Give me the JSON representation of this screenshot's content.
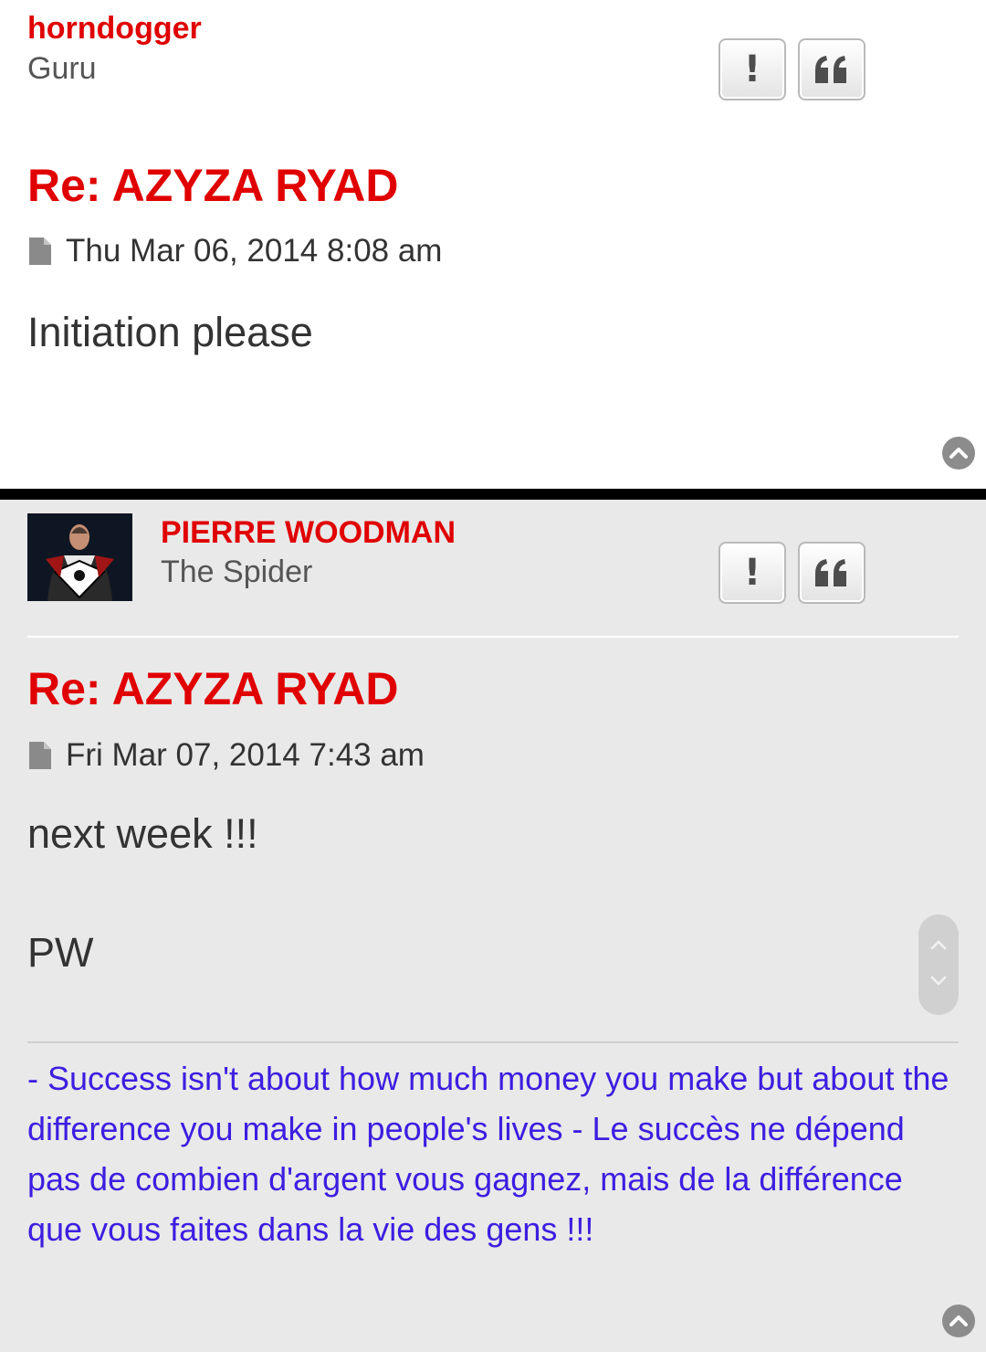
{
  "posts": [
    {
      "author": {
        "name": "horndogger",
        "rank": "Guru"
      },
      "buttons": {
        "report_label": "!"
      },
      "title": "Re: AZYZA RYAD",
      "date": "Thu Mar 06, 2014 8:08 am",
      "content": [
        "Initiation please"
      ]
    },
    {
      "author": {
        "name": "PIERRE WOODMAN",
        "rank": "The Spider"
      },
      "buttons": {
        "report_label": "!"
      },
      "title": "Re: AZYZA RYAD",
      "date": "Fri Mar 07, 2014 7:43 am",
      "content": [
        "next week !!!",
        "PW"
      ],
      "signature": "- Success isn't about how much money you make but about the difference you make in people's lives - Le succès ne dépend pas de combien d'argent vous gagnez, mais de la différence que vous faites dans la vie des gens !!!"
    }
  ],
  "colors": {
    "accent": "#e00000",
    "signature": "#3c1ee0",
    "post_bg_alt": "#e9e9e9",
    "text": "#333333"
  },
  "icons": [
    "report-icon",
    "quote-icon",
    "post-icon",
    "back-to-top-icon",
    "scroll-up-icon",
    "scroll-down-icon"
  ]
}
